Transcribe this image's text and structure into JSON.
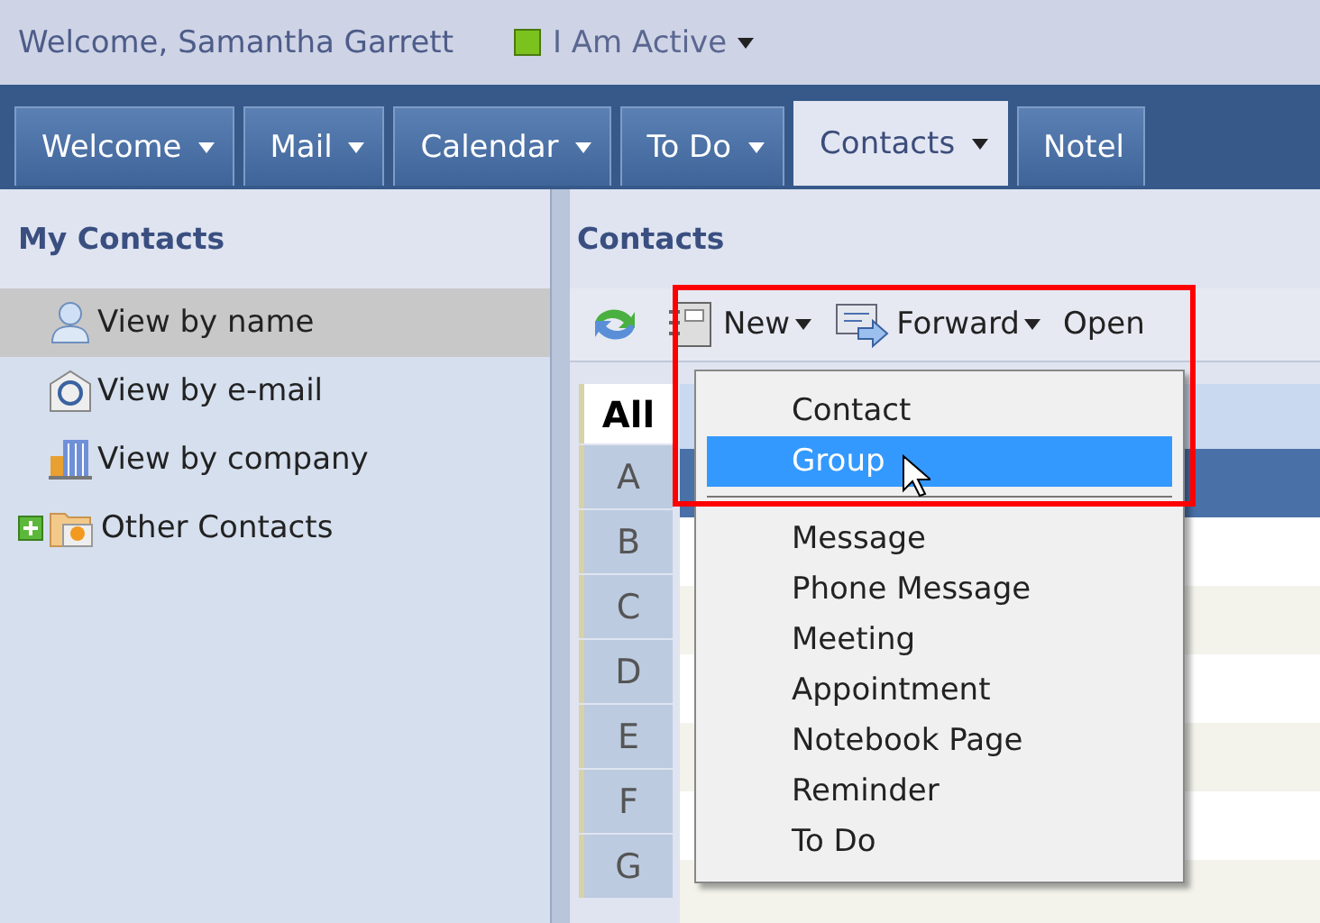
{
  "header": {
    "welcome": "Welcome, Samantha Garrett",
    "status": {
      "label": "I Am Active",
      "color": "#7cc21e"
    }
  },
  "tabs": [
    {
      "label": "Welcome",
      "selected": false
    },
    {
      "label": "Mail",
      "selected": false
    },
    {
      "label": "Calendar",
      "selected": false
    },
    {
      "label": "To Do",
      "selected": false
    },
    {
      "label": "Contacts",
      "selected": true
    },
    {
      "label": "Notel",
      "selected": false
    }
  ],
  "sidebar": {
    "title": "My Contacts",
    "items": [
      {
        "label": "View by name",
        "kind": "person",
        "selected": true
      },
      {
        "label": "View by e-mail",
        "kind": "email",
        "selected": false
      },
      {
        "label": "View by company",
        "kind": "building",
        "selected": false
      },
      {
        "label": "Other Contacts",
        "kind": "folder",
        "selected": false,
        "expanded": false
      }
    ]
  },
  "main": {
    "title": "Contacts",
    "toolbar": [
      {
        "kind": "refresh"
      },
      {
        "kind": "new",
        "label": "New"
      },
      {
        "kind": "forward",
        "label": "Forward"
      },
      {
        "kind": "open",
        "label": "Open"
      }
    ],
    "letters": [
      {
        "label": "All",
        "selected": true
      },
      {
        "label": "A",
        "selected": false
      },
      {
        "label": "B",
        "selected": false
      },
      {
        "label": "C",
        "selected": false
      },
      {
        "label": "D",
        "selected": false
      },
      {
        "label": "E",
        "selected": false
      },
      {
        "label": "F",
        "selected": false
      },
      {
        "label": "G",
        "selected": false
      }
    ],
    "rows": [
      {
        "selected": false
      },
      {
        "selected": true
      },
      {
        "selected": false
      },
      {
        "selected": false
      },
      {
        "selected": false
      },
      {
        "selected": false
      },
      {
        "selected": false
      }
    ]
  },
  "menu": {
    "groups": [
      {
        "items": [
          {
            "label": "Contact",
            "selected": false
          },
          {
            "label": "Group",
            "selected": true
          }
        ]
      },
      {
        "items": [
          {
            "label": "Message",
            "selected": false
          },
          {
            "label": "Phone Message",
            "selected": false
          },
          {
            "label": "Meeting",
            "selected": false
          },
          {
            "label": "Appointment",
            "selected": false
          },
          {
            "label": "Notebook Page",
            "selected": false
          },
          {
            "label": "Reminder",
            "selected": false
          },
          {
            "label": "To Do",
            "selected": false
          }
        ]
      }
    ]
  },
  "annotation_frame": true
}
